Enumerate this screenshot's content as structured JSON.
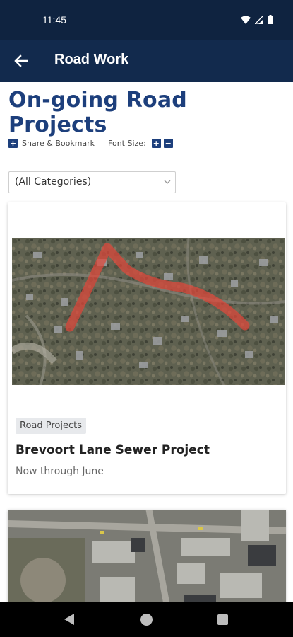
{
  "status_bar": {
    "time": "11:45"
  },
  "app_bar": {
    "title": "Road Work"
  },
  "page": {
    "title": "On-going Road Projects",
    "share_label": "Share & Bookmark",
    "font_size_label": "Font Size:",
    "font_increase": "+",
    "font_decrease": "−",
    "category_select": "(All Categories)"
  },
  "projects": [
    {
      "category": "Road Projects",
      "title": "Brevoort Lane Sewer Project",
      "subtitle": "Now through June"
    }
  ],
  "colors": {
    "status_bar": "#0f2340",
    "app_bar": "#122a4d",
    "accent": "#1d3f7c",
    "route_overlay": "#e0473a"
  }
}
